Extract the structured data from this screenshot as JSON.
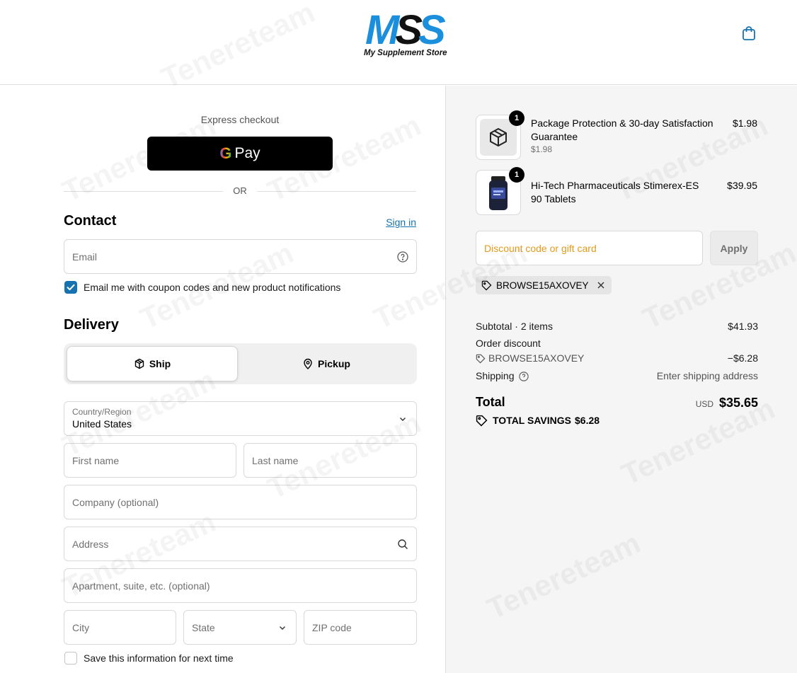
{
  "header": {
    "logo_letters": "MSS",
    "logo_tagline": "My Supplement Store",
    "cart_icon": "shopping-bag-icon"
  },
  "express": {
    "label": "Express checkout",
    "gpay_g": "G",
    "gpay_label": "Pay",
    "or_label": "OR"
  },
  "contact": {
    "title": "Contact",
    "signin_label": "Sign in",
    "email_placeholder": "Email",
    "marketing_label": "Email me with coupon codes and new product notifications",
    "marketing_checked": true
  },
  "delivery": {
    "title": "Delivery",
    "options": [
      {
        "label": "Ship",
        "icon": "package-icon",
        "active": true
      },
      {
        "label": "Pickup",
        "icon": "location-pin-icon",
        "active": false
      }
    ],
    "country_label": "Country/Region",
    "country_value": "United States",
    "first_name_placeholder": "First name",
    "last_name_placeholder": "Last name",
    "company_placeholder": "Company (optional)",
    "address_placeholder": "Address",
    "apartment_placeholder": "Apartment, suite, etc. (optional)",
    "city_placeholder": "City",
    "state_placeholder": "State",
    "zip_placeholder": "ZIP code",
    "save_info_label": "Save this information for next time",
    "save_info_checked": false
  },
  "order": {
    "items": [
      {
        "qty": "1",
        "name_line1": "Package Protection & 30-day Satisfaction",
        "name_line2": "Guarantee",
        "unit_price": "$1.98",
        "price": "$1.98"
      },
      {
        "qty": "1",
        "name_line1": "Hi-Tech Pharmaceuticals Stimerex-ES",
        "name_line2": "90 Tablets",
        "price": "$39.95"
      }
    ],
    "discount_placeholder": "Discount code or gift card",
    "apply_label": "Apply",
    "applied_code": "BROWSE15AXOVEY",
    "subtotal_label": "Subtotal · 2 items",
    "subtotal_value": "$41.93",
    "order_discount_label": "Order discount",
    "discount_code": "BROWSE15AXOVEY",
    "discount_value": "−$6.28",
    "shipping_label": "Shipping",
    "shipping_value": "Enter shipping address",
    "total_label": "Total",
    "currency": "USD",
    "total_value": "$35.65",
    "savings_label": "TOTAL SAVINGS",
    "savings_value": "$6.28"
  },
  "watermark_text": "Tenereteam",
  "colors": {
    "link": "#1773b0",
    "checkbox": "#1773b0",
    "discount_placeholder": "#e39a1c",
    "logo_blue": "#1b8fdc"
  }
}
